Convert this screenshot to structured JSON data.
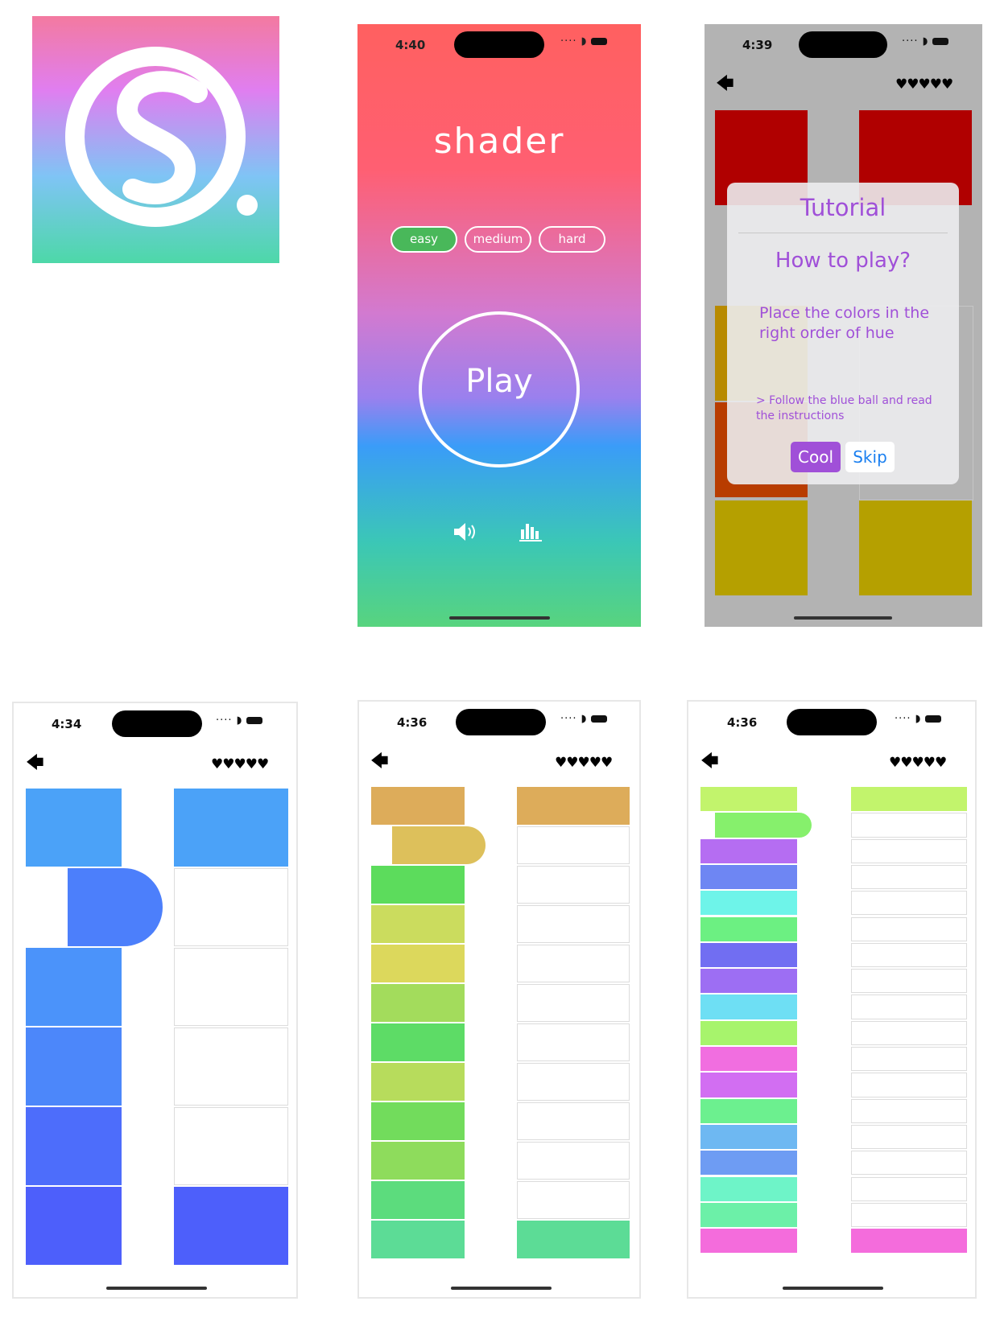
{
  "menu": {
    "time": "4:40",
    "title": "shader",
    "difficulty": [
      "easy",
      "medium",
      "hard"
    ],
    "play": "Play",
    "colors": {
      "easy_selected": "#49b85a"
    }
  },
  "tutorial": {
    "time": "4:39",
    "title": "Tutorial",
    "heading": "How to play?",
    "body": "Place the colors in the right order of hue",
    "hint": "> Follow the blue ball and read the instructions",
    "cool": "Cool",
    "skip": "Skip",
    "hearts": "♥♥♥♥♥",
    "back": "🡄"
  },
  "game_easy": {
    "time": "4:34",
    "hearts": "♥♥♥♥♥",
    "back": "🡄",
    "left_colors": [
      "#4ba2f8",
      "#4c7ffb",
      "#4b93fa",
      "#4c87fa",
      "#4d6dfb",
      "#4d5ffb"
    ],
    "right_colors": [
      "#4ba2f8",
      null,
      null,
      null,
      null,
      "#4d5ffb"
    ]
  },
  "game_medium": {
    "time": "4:36",
    "hearts": "♥♥♥♥♥",
    "back": "🡄",
    "left_colors": [
      "#ddac5a",
      "#ddc05b",
      "#5cdc5c",
      "#cbdc5e",
      "#dcd85c",
      "#a3dc5c",
      "#5ddc66",
      "#b7dc5c",
      "#72dc5c",
      "#8edc5c",
      "#5cdc7d",
      "#5cdc96"
    ],
    "right_colors": [
      "#ddac5a",
      null,
      null,
      null,
      null,
      null,
      null,
      null,
      null,
      null,
      null,
      "#5cdc96"
    ]
  },
  "game_hard": {
    "time": "4:36",
    "hearts": "♥♥♥♥♥",
    "back": "🡄",
    "left_colors": [
      "#c2f46c",
      "#86f06c",
      "#b56df2",
      "#6e86f3",
      "#6ef4e9",
      "#6cf082",
      "#716ef2",
      "#9d6ef3",
      "#6edff4",
      "#a7f46c",
      "#f16ee0",
      "#d26ef2",
      "#6cf08f",
      "#6eb8f2",
      "#6e9cf3",
      "#6ef4c8",
      "#6cf0a8",
      "#f46cdc"
    ],
    "right_colors": [
      "#c2f46c",
      null,
      null,
      null,
      null,
      null,
      null,
      null,
      null,
      null,
      null,
      null,
      null,
      null,
      null,
      null,
      null,
      "#f46cdc"
    ]
  }
}
